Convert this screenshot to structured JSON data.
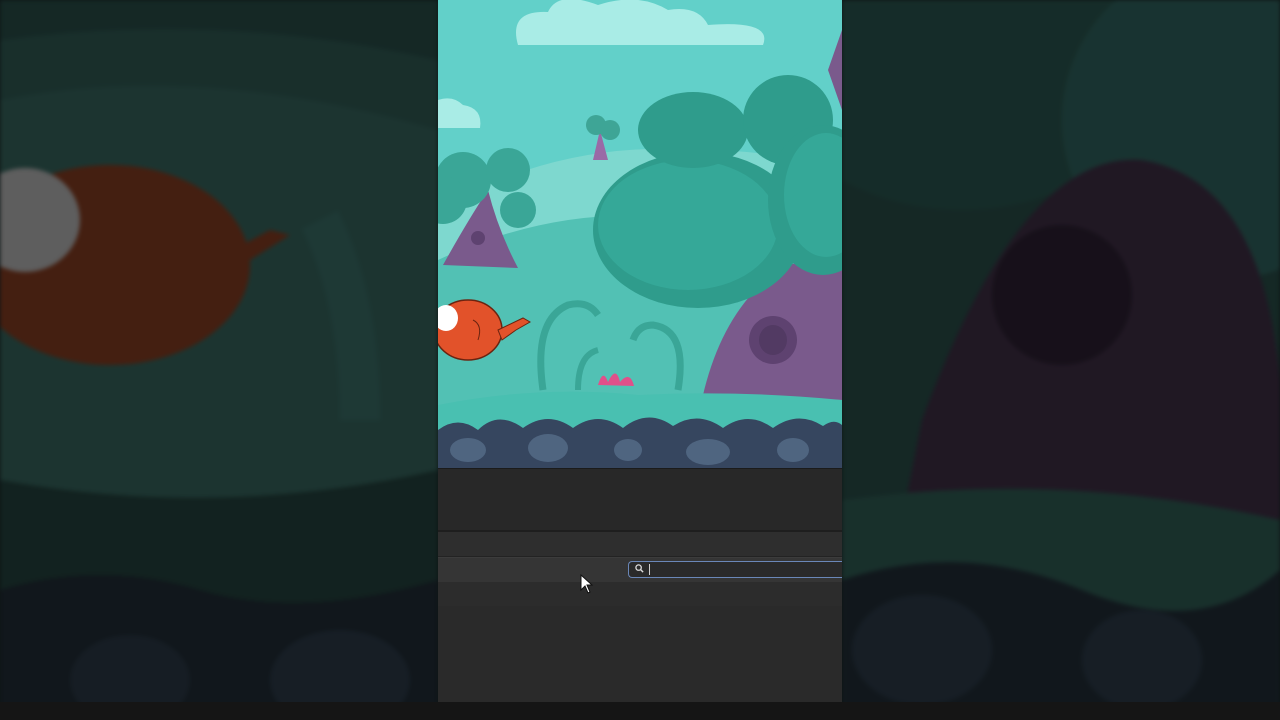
{
  "game": {
    "characters": [
      {
        "name": "orange-bird",
        "color": "#e2522a"
      }
    ],
    "palette": {
      "sky": "#5ad1c8",
      "hills": "#3fb8a8",
      "foliage": "#2f9c8c",
      "trunk": "#7a5a8c",
      "ground": "#3a4a66"
    }
  },
  "editor": {
    "search": {
      "placeholder": "",
      "value": ""
    },
    "icons": {
      "search": "search-icon",
      "cursor": "mouse-pointer-icon"
    }
  }
}
